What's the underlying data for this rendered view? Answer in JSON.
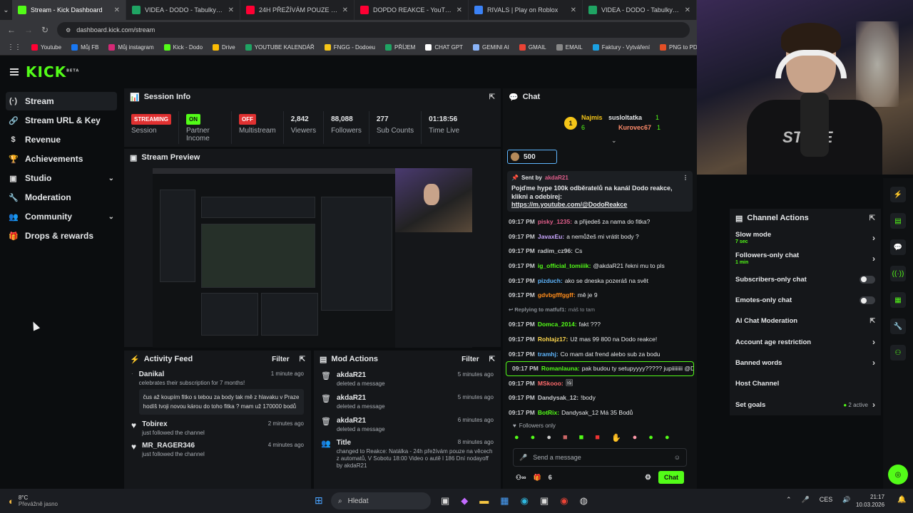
{
  "browser": {
    "tabs": [
      {
        "title": "Stream - Kick Dashboard",
        "color": "#53fc18"
      },
      {
        "title": "VIDEA - DODO - Tabulky Googl",
        "color": "#1fa463"
      },
      {
        "title": "24H PŘEŽÍVÁM POUZE NA VĚC",
        "color": "#ff0033"
      },
      {
        "title": "DOPDO REAKCE - YouTube",
        "color": "#ff0033"
      },
      {
        "title": "RIVALS | Play on Roblox",
        "color": "#3b82f6"
      },
      {
        "title": "VIDEA - DODO - Tabulky Googl",
        "color": "#1fa463"
      }
    ],
    "url": "dashboard.kick.com/stream",
    "bookmarks": [
      {
        "label": "Youtube",
        "color": "#ff0033"
      },
      {
        "label": "Můj FB",
        "color": "#1877f2"
      },
      {
        "label": "Můj instagram",
        "color": "#d62976"
      },
      {
        "label": "Kick - Dodo",
        "color": "#53fc18"
      },
      {
        "label": "Drive",
        "color": "#fbbc04"
      },
      {
        "label": "YOUTUBE KALENDÁŘ",
        "color": "#1fa463"
      },
      {
        "label": "FNGG - Dodoeu",
        "color": "#f5c518"
      },
      {
        "label": "PŘÍJEM",
        "color": "#1fa463"
      },
      {
        "label": "CHAT GPT",
        "color": "#ffffff"
      },
      {
        "label": "GEMINI AI",
        "color": "#8ab4f8"
      },
      {
        "label": "GMAIL",
        "color": "#ea4335"
      },
      {
        "label": "EMAIL",
        "color": "#888888"
      },
      {
        "label": "Faktury - Vytváření",
        "color": "#1ba1e2"
      },
      {
        "label": "PNG to PDF",
        "color": "#e34f26"
      }
    ]
  },
  "brand": {
    "logo": "KICK",
    "beta": "BETA",
    "accent": "#53fc18"
  },
  "sidebar": {
    "items": [
      {
        "label": "Stream",
        "icon": "(·)"
      },
      {
        "label": "Stream URL & Key",
        "icon": "🔗"
      },
      {
        "label": "Revenue",
        "icon": "$"
      },
      {
        "label": "Achievements",
        "icon": "🏆"
      },
      {
        "label": "Studio",
        "icon": "▣"
      },
      {
        "label": "Moderation",
        "icon": "🔧"
      },
      {
        "label": "Community",
        "icon": "👥"
      },
      {
        "label": "Drops & rewards",
        "icon": "🎁"
      }
    ]
  },
  "session": {
    "title": "Session Info",
    "streaming_badge": "STREAMING",
    "session_label": "Session",
    "partner_badge": "ON",
    "partner_label": "Partner Income",
    "multistream_badge": "OFF",
    "multistream_label": "Multistream",
    "viewers": "2,842",
    "viewers_label": "Viewers",
    "followers": "88,088",
    "followers_label": "Followers",
    "subs": "277",
    "subs_label": "Sub Counts",
    "time": "01:18:56",
    "time_label": "Time Live"
  },
  "preview": {
    "title": "Stream Preview"
  },
  "activity": {
    "title": "Activity Feed",
    "filter": "Filter",
    "items": [
      {
        "user": "Danikal",
        "text": "celebrates their subscription for 7 months!",
        "time": "1 minute ago",
        "quote": "čus až koupím fitko s tebou za body tak mě z hlavaku v Praze hodíš tvoji novou károu do toho fitka ? mam už 170000 bodů"
      },
      {
        "user": "Tobirex",
        "text": "just followed the channel",
        "time": "2 minutes ago"
      },
      {
        "user": "MR_RAGER346",
        "text": "just followed the channel",
        "time": "4 minutes ago"
      }
    ]
  },
  "mod": {
    "title": "Mod Actions",
    "filter": "Filter",
    "items": [
      {
        "user": "akdaR21",
        "text": "deleted a message",
        "time": "5 minutes ago"
      },
      {
        "user": "akdaR21",
        "text": "deleted a message",
        "time": "5 minutes ago"
      },
      {
        "user": "akdaR21",
        "text": "deleted a message",
        "time": "6 minutes ago"
      }
    ],
    "title_change": {
      "label": "Title",
      "time": "8 minutes ago",
      "text": "changed to Reakce: Natálka - 24h přežívám pouze na věcech z automatů, V Sobotu 18:00 Video o autě l 186 Dní nodayoff by akdaR21"
    }
  },
  "chat": {
    "title": "Chat",
    "leaders": {
      "first": "Najmis",
      "first_count": "6",
      "second": "susloltatka",
      "second_count": "1",
      "third": "Kurovec67",
      "third_count": "1"
    },
    "kicks": "500",
    "pinned": {
      "by": "Sent by",
      "user": "akdaR21",
      "text": "Pojďme hype 100k odběratelů na kanál Dodo reakce, klikni a odebírej:",
      "link": "https://m.youtube.com/@DodoReakce"
    },
    "messages": [
      {
        "time": "09:17 PM",
        "user": "pisky_1235:",
        "color": "#e05d8a",
        "text": "a přijedeš za nama do fitka?"
      },
      {
        "time": "09:17 PM",
        "user": "JavaxEu:",
        "color": "#c9a7ff",
        "text": "a nemůžeš mi vrátit body ?"
      },
      {
        "time": "09:17 PM",
        "user": "radim_cz96:",
        "color": "#c9cbce",
        "text": "Cs"
      },
      {
        "time": "09:17 PM",
        "user": "ig_official_tomiiik:",
        "color": "#53fc18",
        "text": "@akdaR21 řekni mu to pls"
      },
      {
        "time": "09:17 PM",
        "user": "pizduch:",
        "color": "#5fb7ff",
        "text": "ako se dneska pozeráš na svět"
      },
      {
        "time": "09:17 PM",
        "user": "gdvbgfffggff:",
        "color": "#ff8c1a",
        "text": "mě je 9"
      },
      {
        "time": "",
        "user": "↩ Replying to matfuf1:",
        "color": "#8a8f96",
        "text": "máš to tam"
      },
      {
        "time": "09:17 PM",
        "user": "Domca_2014:",
        "color": "#53fc18",
        "text": "fakt ???"
      },
      {
        "time": "09:17 PM",
        "user": "Rohlajz17:",
        "color": "#ffd84d",
        "text": "Už mas 99 800 na Dodo reakce!"
      },
      {
        "time": "09:17 PM",
        "user": "tramhj:",
        "color": "#5fb7ff",
        "text": "Co mam dat frend alebo sub za bodu"
      },
      {
        "time": "09:17 PM",
        "user": "Romanlauna:",
        "color": "#53fc18",
        "text": "pak budou ty setupyyyy????? jupiiiiiiii @Dodo",
        "hl": true
      },
      {
        "time": "09:17 PM",
        "user": "MSkooo:",
        "color": "#ff6b6b",
        "text": "🖼"
      },
      {
        "time": "09:17 PM",
        "user": "Dandysak_12:",
        "color": "#c9cbce",
        "text": "!body"
      },
      {
        "time": "09:17 PM",
        "user": "BotRix:",
        "color": "#53fc18",
        "text": "Dandysak_12 Má 35 Bodů"
      }
    ],
    "followers_only": "Followers only",
    "placeholder": "Send a message",
    "viewer_count": "6",
    "send": "Chat"
  },
  "channel_actions": {
    "title": "Channel Actions",
    "rows": [
      {
        "label": "Slow mode",
        "sub": "7 sec",
        "kind": "arrow"
      },
      {
        "label": "Followers-only chat",
        "sub": "1 min",
        "kind": "arrow"
      },
      {
        "label": "Subscribers-only chat",
        "sub": "",
        "kind": "toggle"
      },
      {
        "label": "Emotes-only chat",
        "sub": "",
        "kind": "toggle"
      },
      {
        "label": "AI Chat Moderation",
        "sub": "",
        "kind": "ext"
      },
      {
        "label": "Account age restriction",
        "sub": "",
        "kind": "arrow"
      },
      {
        "label": "Banned words",
        "sub": "",
        "kind": "arrow"
      },
      {
        "label": "Host Channel",
        "sub": "",
        "kind": "none"
      },
      {
        "label": "Set goals",
        "sub": "",
        "kind": "goals",
        "extra": "2 active"
      }
    ]
  },
  "taskbar": {
    "temp": "8°C",
    "weather": "Převážně jasno",
    "search": "Hledat",
    "lang": "CES",
    "time": "21:17",
    "date": "10.03.2026"
  }
}
